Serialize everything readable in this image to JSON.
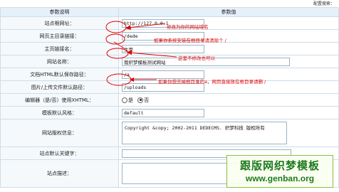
{
  "top_right": "配置搜索：",
  "table": {
    "col_param": "参数说明",
    "col_value": "参数值"
  },
  "rows": {
    "site_url": {
      "label": "站点根网址：",
      "value": "http://127.0.0.1"
    },
    "web_root": {
      "label": "网页主目录链接：",
      "value": "/dede"
    },
    "main_domain": {
      "label": "主页链接名：",
      "value": "主页"
    },
    "site_name": {
      "label": "网站名称：",
      "value": "我织梦模板测试网站"
    },
    "html_dir": {
      "label": "文档HTML默认保存路径：",
      "value": "/a"
    },
    "upload_dir": {
      "label": "图片/上传文件默认路径：",
      "value": "/uploads"
    },
    "xhtml": {
      "label": "编辑器（是/否）使用XHTML：",
      "option_yes": "是",
      "option_no": "否",
      "selected": "否"
    },
    "style": {
      "label": "模板默认风格：",
      "value": "default"
    },
    "copyright": {
      "label": "网站版权信息：",
      "value": "Copyright &copy; 2002-2011 DEDECMS. 织梦科技 版权所有"
    },
    "keywords": {
      "label": "站点默认关键字：",
      "value": ""
    },
    "description": {
      "label": "站点描述：",
      "value": ""
    }
  },
  "annotations": {
    "note1": "修改为你的网站域名",
    "note2": "如果你系统安装在根目录请清除个 /",
    "note3": "这里不修改也可以",
    "note4": "如果你想去掉根目录的a，网页直接放在根目录请删 /"
  },
  "watermark": {
    "line1": "跟版网织梦模板",
    "line2": "www.genban.org"
  }
}
